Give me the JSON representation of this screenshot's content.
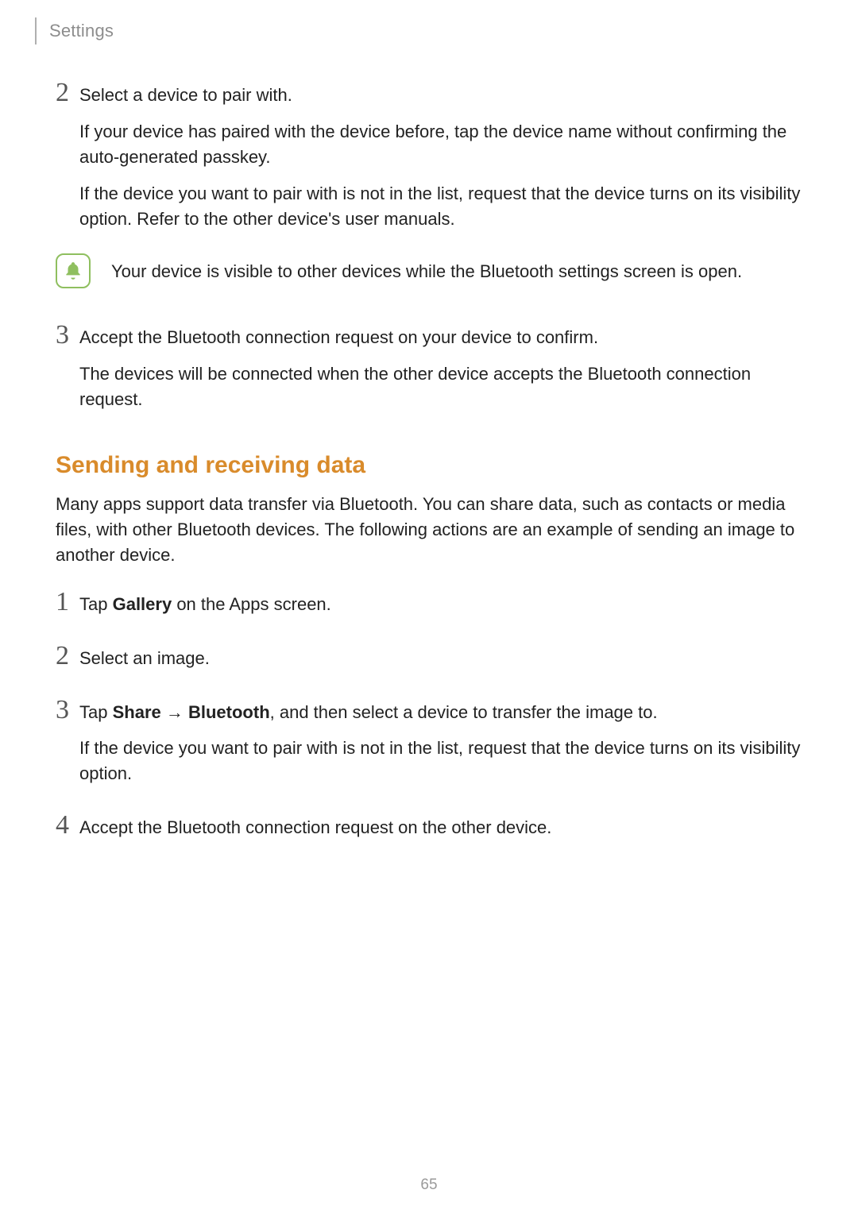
{
  "header": {
    "section": "Settings"
  },
  "stepsA": {
    "n2": "2",
    "s2_head": "Select a device to pair with.",
    "s2_p1": "If your device has paired with the device before, tap the device name without confirming the auto-generated passkey.",
    "s2_p2": "If the device you want to pair with is not in the list, request that the device turns on its visibility option. Refer to the other device's user manuals.",
    "note": "Your device is visible to other devices while the Bluetooth settings screen is open.",
    "n3": "3",
    "s3_head": "Accept the Bluetooth connection request on your device to confirm.",
    "s3_p1": "The devices will be connected when the other device accepts the Bluetooth connection request."
  },
  "subheading": "Sending and receiving data",
  "intro": "Many apps support data transfer via Bluetooth. You can share data, such as contacts or media files, with other Bluetooth devices. The following actions are an example of sending an image to another device.",
  "stepsB": {
    "n1": "1",
    "s1_pre": "Tap ",
    "s1_bold": "Gallery",
    "s1_post": " on the Apps screen.",
    "n2": "2",
    "s2_head": "Select an image.",
    "n3": "3",
    "s3_pre": "Tap ",
    "s3_bold1": "Share",
    "s3_arrow": " → ",
    "s3_bold2": "Bluetooth",
    "s3_post": ", and then select a device to transfer the image to.",
    "s3_p1": "If the device you want to pair with is not in the list, request that the device turns on its visibility option.",
    "n4": "4",
    "s4_head": "Accept the Bluetooth connection request on the other device."
  },
  "page_number": "65"
}
